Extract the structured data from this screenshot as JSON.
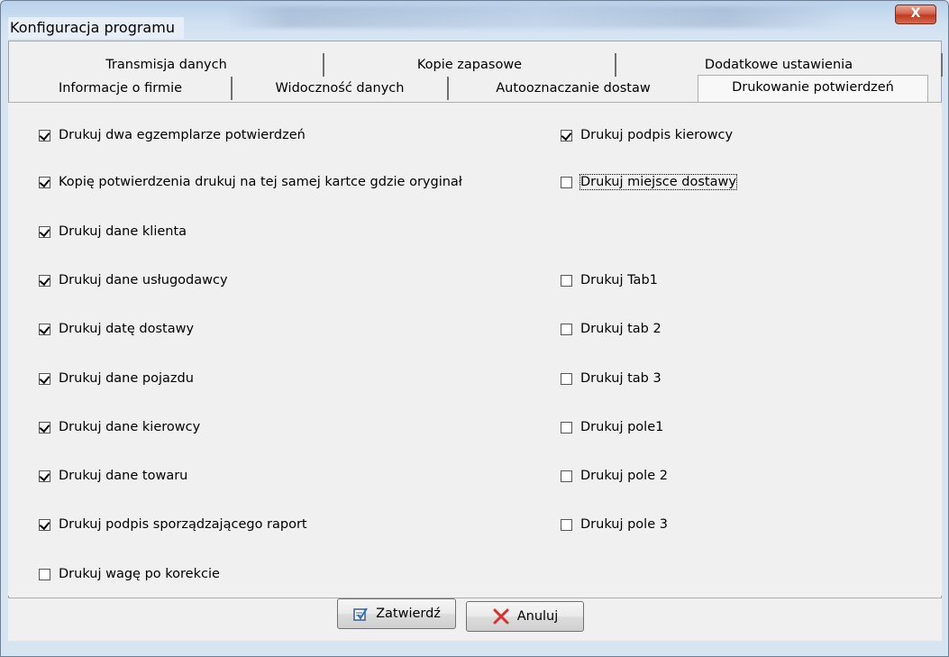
{
  "window": {
    "title": "Konfiguracja programu",
    "close_glyph": "X"
  },
  "tabs_row1": [
    {
      "label": "Transmisja danych"
    },
    {
      "label": "Kopie zapasowe"
    },
    {
      "label": "Dodatkowe ustawienia"
    }
  ],
  "tabs_row2": [
    {
      "label": "Informacje o firmie"
    },
    {
      "label": "Widoczność danych"
    },
    {
      "label": "Autooznaczanie dostaw"
    },
    {
      "label": "Drukowanie potwierdzeń",
      "active": true
    }
  ],
  "left_options": [
    {
      "label": "Drukuj dwa egzemplarze potwierdzeń",
      "checked": true
    },
    {
      "label": "Kopię potwierdzenia drukuj na tej samej kartce gdzie oryginał",
      "checked": true
    },
    {
      "label": "Drukuj dane klienta",
      "checked": true
    },
    {
      "label": "Drukuj dane usługodawcy",
      "checked": true
    },
    {
      "label": "Drukuj datę dostawy",
      "checked": true
    },
    {
      "label": "Drukuj dane pojazdu",
      "checked": true
    },
    {
      "label": "Drukuj dane kierowcy",
      "checked": true
    },
    {
      "label": "Drukuj  dane towaru",
      "checked": true
    },
    {
      "label": "Drukuj podpis sporządzającego raport",
      "checked": true
    },
    {
      "label": "Drukuj wagę po korekcie",
      "checked": false
    }
  ],
  "right_options": [
    {
      "label": "Drukuj  podpis kierowcy",
      "checked": true
    },
    {
      "label": "Drukuj miejsce dostawy",
      "checked": false,
      "focused": true
    },
    {
      "label": "Drukuj Tab1",
      "checked": false
    },
    {
      "label": "Drukuj tab 2",
      "checked": false
    },
    {
      "label": "Drukuj tab 3",
      "checked": false
    },
    {
      "label": "Drukuj pole1",
      "checked": false
    },
    {
      "label": "Drukuj pole 2",
      "checked": false
    },
    {
      "label": "Drukuj pole 3",
      "checked": false
    }
  ],
  "buttons": {
    "confirm": "Zatwierdź",
    "cancel": "Anuluj"
  },
  "icons": {
    "confirm": "confirm-check-icon",
    "cancel": "cancel-x-icon"
  },
  "colors": {
    "cancel_x": "#d9302c",
    "close_button": "#c8442b"
  }
}
